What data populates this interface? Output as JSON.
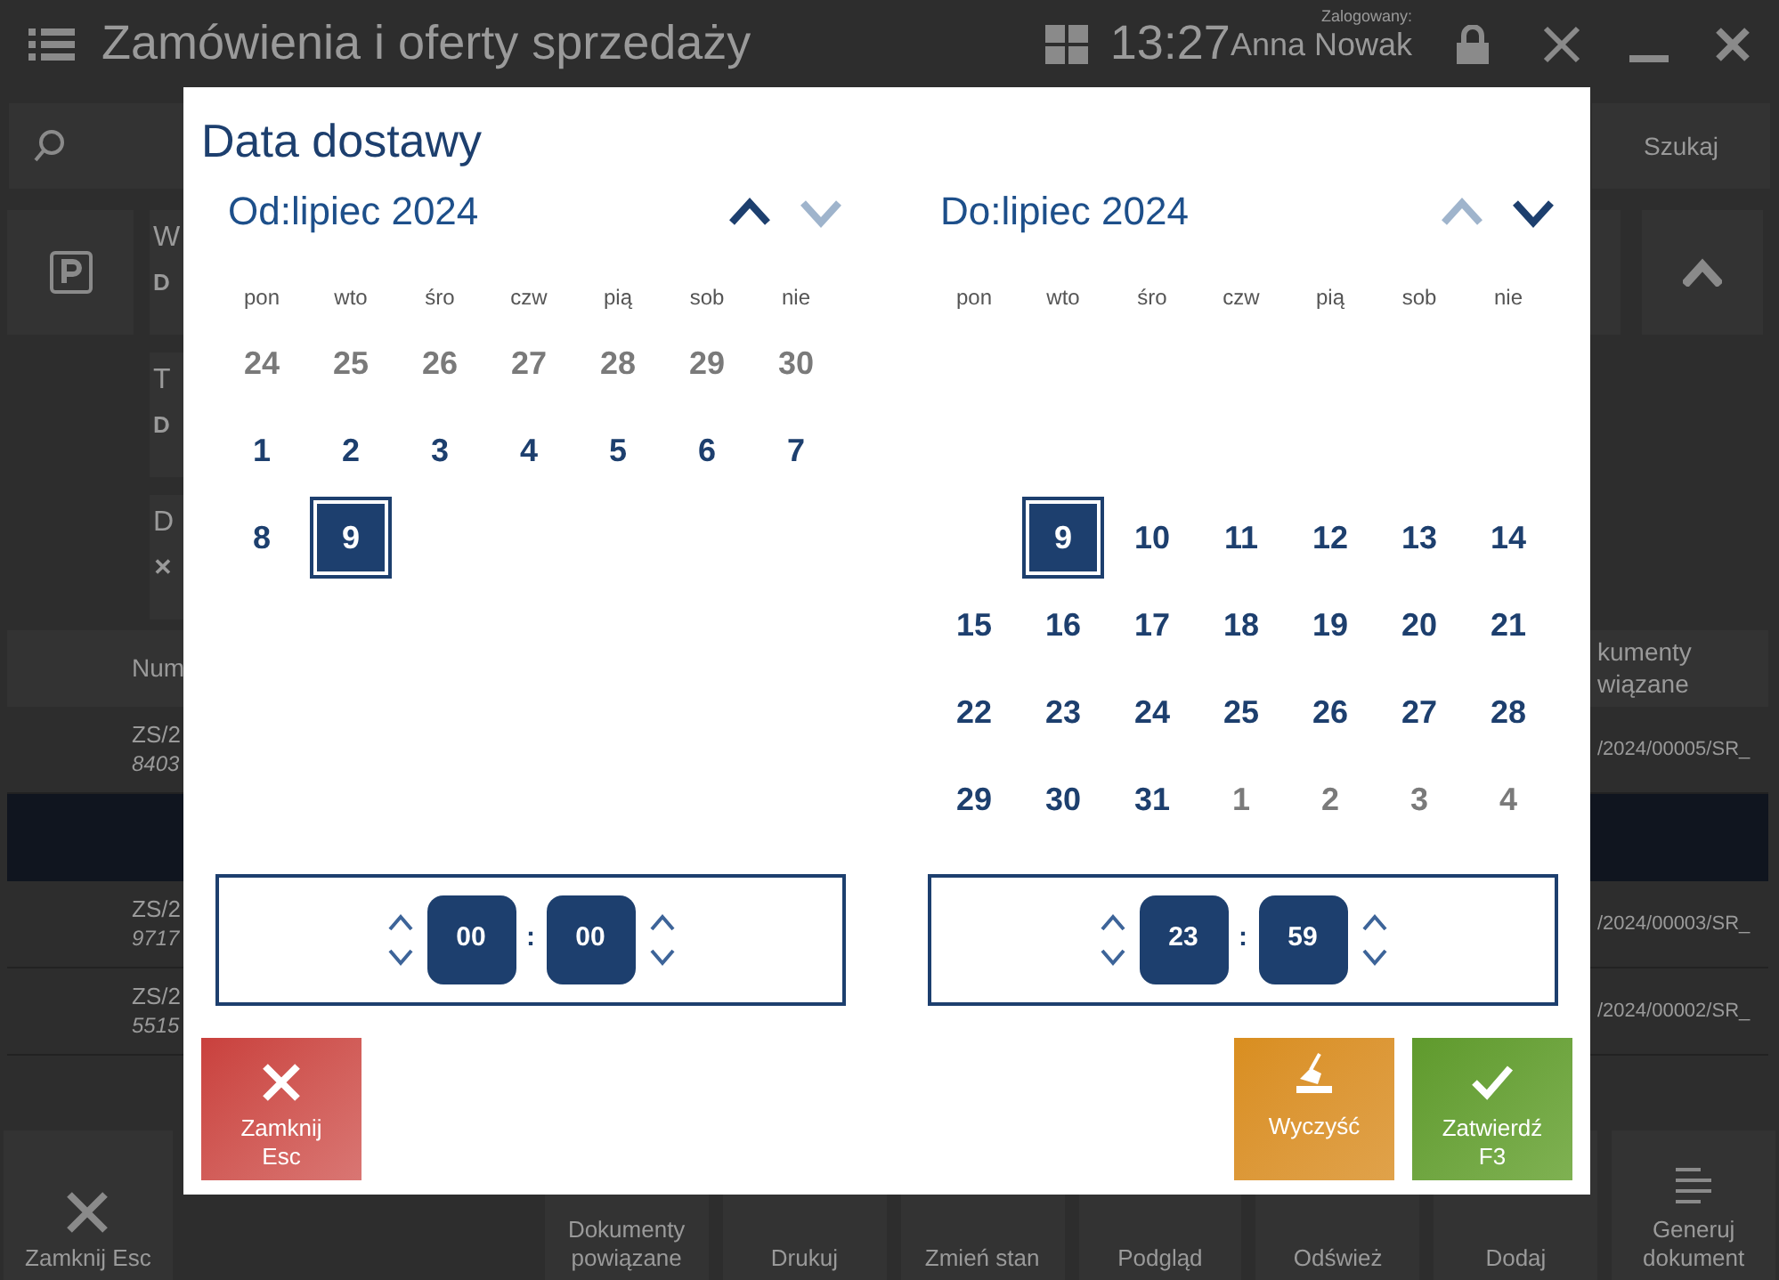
{
  "header": {
    "title": "Zamówienia i oferty sprzedaży",
    "time": "13:27",
    "logged_label": "Zalogowany:",
    "user": "Anna Nowak"
  },
  "search": {
    "button": "Szukaj"
  },
  "left_cards": [
    {
      "title": "W",
      "subtitle": "D"
    },
    {
      "title": "T",
      "subtitle": "D"
    },
    {
      "title": "D",
      "subtitle": "✕"
    }
  ],
  "table": {
    "columns": [
      {
        "label": "Num"
      },
      {
        "label": "kumenty wiązane"
      }
    ],
    "rows": [
      {
        "number": "ZS/2",
        "code": "8403",
        "related": "/2024/00005/SR_",
        "selected": false
      },
      {
        "selected": true
      },
      {
        "number": "ZS/2",
        "code": "9717",
        "related": "/2024/00003/SR_",
        "selected": false
      },
      {
        "number": "ZS/2",
        "code": "5515",
        "related": "/2024/00002/SR_",
        "selected": false
      }
    ]
  },
  "toolbar": [
    {
      "label": "Zamknij Esc",
      "kind": "close"
    },
    {
      "label": "Dokumenty powiązane",
      "kind": "text"
    },
    {
      "label": "Drukuj",
      "kind": "text"
    },
    {
      "label": "Zmień stan",
      "kind": "text"
    },
    {
      "label": "Podgląd",
      "kind": "text"
    },
    {
      "label": "Odśwież",
      "kind": "text"
    },
    {
      "label": "Dodaj",
      "kind": "text"
    },
    {
      "label": "Generuj dokument",
      "kind": "generate"
    }
  ],
  "dialog": {
    "title": "Data dostawy",
    "calendars": [
      {
        "label": "Od:lipiec 2024",
        "prev_enabled": true,
        "next_enabled": false,
        "weekdays": [
          "pon",
          "wto",
          "śro",
          "czw",
          "pią",
          "sob",
          "nie"
        ],
        "days": [
          {
            "kind": "day",
            "label": "24",
            "muted": true,
            "selected": false
          },
          {
            "kind": "day",
            "label": "25",
            "muted": true,
            "selected": false
          },
          {
            "kind": "day",
            "label": "26",
            "muted": true,
            "selected": false
          },
          {
            "kind": "day",
            "label": "27",
            "muted": true,
            "selected": false
          },
          {
            "kind": "day",
            "label": "28",
            "muted": true,
            "selected": false
          },
          {
            "kind": "day",
            "label": "29",
            "muted": true,
            "selected": false
          },
          {
            "kind": "day",
            "label": "30",
            "muted": true,
            "selected": false
          },
          {
            "kind": "day",
            "label": "1",
            "muted": false,
            "selected": false
          },
          {
            "kind": "day",
            "label": "2",
            "muted": false,
            "selected": false
          },
          {
            "kind": "day",
            "label": "3",
            "muted": false,
            "selected": false
          },
          {
            "kind": "day",
            "label": "4",
            "muted": false,
            "selected": false
          },
          {
            "kind": "day",
            "label": "5",
            "muted": false,
            "selected": false
          },
          {
            "kind": "day",
            "label": "6",
            "muted": false,
            "selected": false
          },
          {
            "kind": "day",
            "label": "7",
            "muted": false,
            "selected": false
          },
          {
            "kind": "day",
            "label": "8",
            "muted": false,
            "selected": false
          },
          {
            "kind": "day",
            "label": "9",
            "muted": false,
            "selected": true
          }
        ],
        "time": {
          "hour": "00",
          "separator": ":",
          "minute": "00"
        }
      },
      {
        "label": "Do:lipiec 2024",
        "prev_enabled": false,
        "next_enabled": true,
        "weekdays": [
          "pon",
          "wto",
          "śro",
          "czw",
          "pią",
          "sob",
          "nie"
        ],
        "days": [
          {
            "kind": "blank"
          },
          {
            "kind": "blank"
          },
          {
            "kind": "blank"
          },
          {
            "kind": "blank"
          },
          {
            "kind": "blank"
          },
          {
            "kind": "blank"
          },
          {
            "kind": "blank"
          },
          {
            "kind": "blank"
          },
          {
            "kind": "blank"
          },
          {
            "kind": "blank"
          },
          {
            "kind": "blank"
          },
          {
            "kind": "blank"
          },
          {
            "kind": "blank"
          },
          {
            "kind": "blank"
          },
          {
            "kind": "blank"
          },
          {
            "kind": "day",
            "label": "9",
            "muted": false,
            "selected": true
          },
          {
            "kind": "day",
            "label": "10",
            "muted": false,
            "selected": false
          },
          {
            "kind": "day",
            "label": "11",
            "muted": false,
            "selected": false
          },
          {
            "kind": "day",
            "label": "12",
            "muted": false,
            "selected": false
          },
          {
            "kind": "day",
            "label": "13",
            "muted": false,
            "selected": false
          },
          {
            "kind": "day",
            "label": "14",
            "muted": false,
            "selected": false
          },
          {
            "kind": "day",
            "label": "15",
            "muted": false,
            "selected": false
          },
          {
            "kind": "day",
            "label": "16",
            "muted": false,
            "selected": false
          },
          {
            "kind": "day",
            "label": "17",
            "muted": false,
            "selected": false
          },
          {
            "kind": "day",
            "label": "18",
            "muted": false,
            "selected": false
          },
          {
            "kind": "day",
            "label": "19",
            "muted": false,
            "selected": false
          },
          {
            "kind": "day",
            "label": "20",
            "muted": false,
            "selected": false
          },
          {
            "kind": "day",
            "label": "21",
            "muted": false,
            "selected": false
          },
          {
            "kind": "day",
            "label": "22",
            "muted": false,
            "selected": false
          },
          {
            "kind": "day",
            "label": "23",
            "muted": false,
            "selected": false
          },
          {
            "kind": "day",
            "label": "24",
            "muted": false,
            "selected": false
          },
          {
            "kind": "day",
            "label": "25",
            "muted": false,
            "selected": false
          },
          {
            "kind": "day",
            "label": "26",
            "muted": false,
            "selected": false
          },
          {
            "kind": "day",
            "label": "27",
            "muted": false,
            "selected": false
          },
          {
            "kind": "day",
            "label": "28",
            "muted": false,
            "selected": false
          },
          {
            "kind": "day",
            "label": "29",
            "muted": false,
            "selected": false
          },
          {
            "kind": "day",
            "label": "30",
            "muted": false,
            "selected": false
          },
          {
            "kind": "day",
            "label": "31",
            "muted": false,
            "selected": false
          },
          {
            "kind": "day",
            "label": "1",
            "muted": true,
            "selected": false
          },
          {
            "kind": "day",
            "label": "2",
            "muted": true,
            "selected": false
          },
          {
            "kind": "day",
            "label": "3",
            "muted": true,
            "selected": false
          },
          {
            "kind": "day",
            "label": "4",
            "muted": true,
            "selected": false
          }
        ],
        "time": {
          "hour": "23",
          "separator": ":",
          "minute": "59"
        }
      }
    ],
    "buttons": [
      {
        "label": "Zamknij",
        "key": "Esc",
        "kind": "close"
      },
      {
        "label": "Wyczyść",
        "kind": "clear"
      },
      {
        "label": "Zatwierdź",
        "key": "F3",
        "kind": "confirm"
      }
    ]
  }
}
